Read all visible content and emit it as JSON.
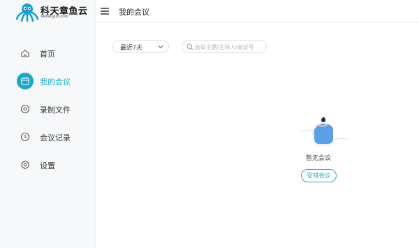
{
  "brand": {
    "name": "科天章鱼云",
    "url": "ketianyun.com",
    "accent_color": "#19aac8"
  },
  "sidebar": {
    "items": [
      {
        "label": "首页",
        "icon": "home-icon",
        "active": false
      },
      {
        "label": "我的会议",
        "icon": "calendar-icon",
        "active": true
      },
      {
        "label": "录制文件",
        "icon": "record-icon",
        "active": false
      },
      {
        "label": "会议记录",
        "icon": "clock-icon",
        "active": false
      },
      {
        "label": "设置",
        "icon": "settings-icon",
        "active": false
      }
    ]
  },
  "header": {
    "title": "我的会议",
    "menu_icon": "hamburger-icon"
  },
  "filters": {
    "range_value": "最近7天",
    "search_placeholder": "会议主题/主持人/会议号",
    "search_value": ""
  },
  "empty_state": {
    "message": "暂无会议",
    "action_label": "安排会议"
  }
}
